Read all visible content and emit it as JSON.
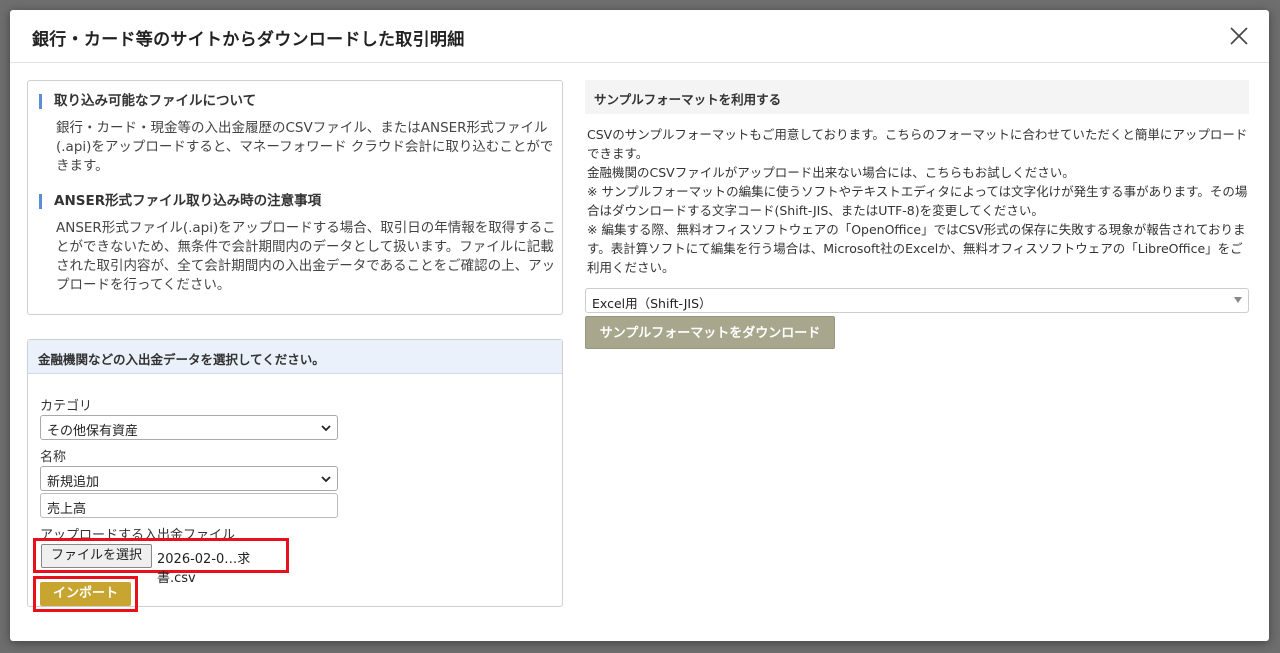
{
  "modal": {
    "title": "銀行・カード等のサイトからダウンロードした取引明細"
  },
  "info": {
    "heading1": "取り込み可能なファイルについて",
    "text1": "銀行・カード・現金等の入出金履歴のCSVファイル、またはANSER形式ファイル(.api)をアップロードすると、マネーフォワード クラウド会計に取り込むことができます。",
    "heading2": "ANSER形式ファイル取り込み時の注意事項",
    "text2": "ANSER形式ファイル(.api)をアップロードする場合、取引日の年情報を取得することができないため、無条件で会計期間内のデータとして扱います。ファイルに記載された取引内容が、全て会計期間内の入出金データであることをご確認の上、アップロードを行ってください。"
  },
  "select_panel": {
    "title": "金融機関などの入出金データを選択してください。",
    "category_label": "カテゴリ",
    "category_value": "その他保有資産",
    "name_label": "名称",
    "name_value": "新規追加",
    "text_value": "売上高",
    "file_label": "アップロードする入出金ファイル",
    "file_button": "ファイルを選択",
    "file_name": "2026-02-0…求書.csv",
    "import_button": "インポート"
  },
  "sample": {
    "title": "サンプルフォーマットを利用する",
    "line1": "CSVのサンプルフォーマットもご用意しております。こちらのフォーマットに合わせていただくと簡単にアップロードできます。",
    "line2": "金融機関のCSVファイルがアップロード出来ない場合には、こちらもお試しください。",
    "line3": "※ サンプルフォーマットの編集に使うソフトやテキストエディタによっては文字化けが発生する事があります。その場合はダウンロードする文字コード(Shift-JIS、またはUTF-8)を変更してください。",
    "line4": "※ 編集する際、無料オフィスソフトウェアの「OpenOffice」ではCSV形式の保存に失敗する現象が報告されております。表計算ソフトにて編集を行う場合は、Microsoft社のExcelか、無料オフィスソフトウェアの「LibreOffice」をご利用ください。",
    "format_value": "Excel用（Shift-JIS）",
    "download_button": "サンプルフォーマットをダウンロード"
  },
  "colors": {
    "import_button": "#c8a530",
    "download_button": "#a8a68c",
    "highlight": "#e8101a",
    "panel_header": "#eaf1fb",
    "heading_bar": "#5b8fd1"
  }
}
